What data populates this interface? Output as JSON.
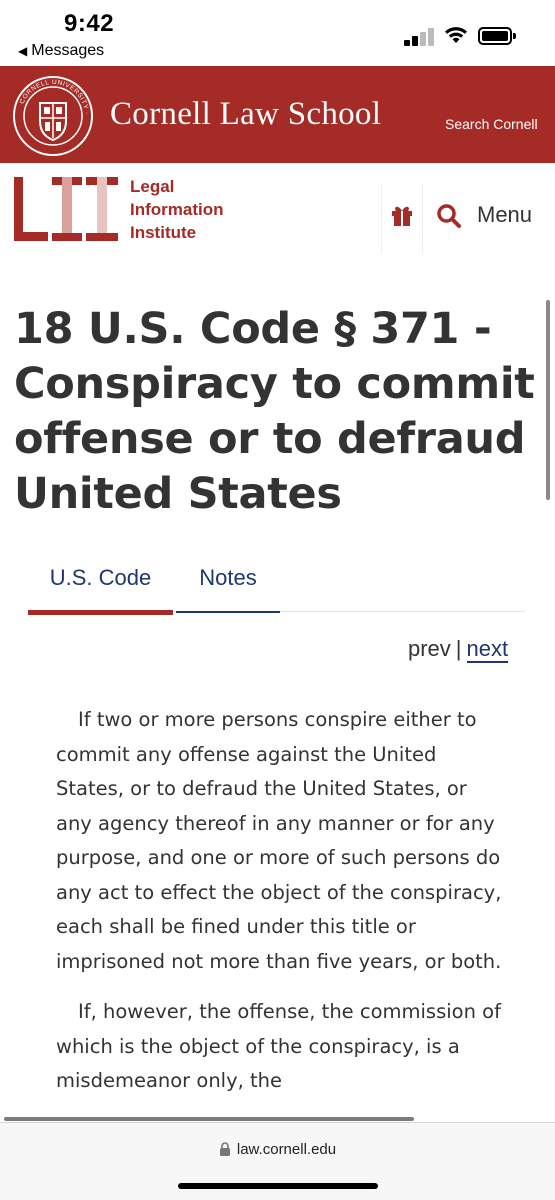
{
  "status_bar": {
    "time": "9:42",
    "back_label": "Messages",
    "icons": [
      "signal-icon",
      "wifi-icon",
      "battery-icon"
    ]
  },
  "cornell_bar": {
    "title": "Cornell Law School",
    "search_label": "Search Cornell",
    "seal_icon": "cornell-seal-icon",
    "seal_text": "CORNELL UNIVERSITY · FOUNDED A.D. 1865",
    "background": "#a42b26"
  },
  "lii_header": {
    "name_lines": [
      "Legal",
      "Information",
      "Institute"
    ],
    "logo_icon": "lii-logo-icon",
    "gift_icon": "gift-icon",
    "search_icon": "search-icon",
    "menu_label": "Menu",
    "accent": "#a42b26"
  },
  "document": {
    "title": "18 U.S. Code § 371 - Conspiracy to commit offense or to defraud United States",
    "tabs": [
      {
        "label": "U.S. Code",
        "active": true
      },
      {
        "label": "Notes",
        "active": false
      }
    ],
    "pager": {
      "prev": "prev",
      "separator": "|",
      "next": "next"
    },
    "paragraphs": [
      "If two or more persons conspire either to commit any offense against the United States, or to defraud the United States, or any agency thereof in any manner or for any purpose, and one or more of such persons do any act to effect the object of the conspiracy, each shall be fined under this title or imprisoned not more than five years, or both.",
      "If, however, the offense, the commission of which is the object of the conspiracy, is a misdemeanor only, the"
    ],
    "link_color": "#1f3770"
  },
  "browser_bar": {
    "url": "law.cornell.edu",
    "lock_icon": "lock-icon"
  }
}
